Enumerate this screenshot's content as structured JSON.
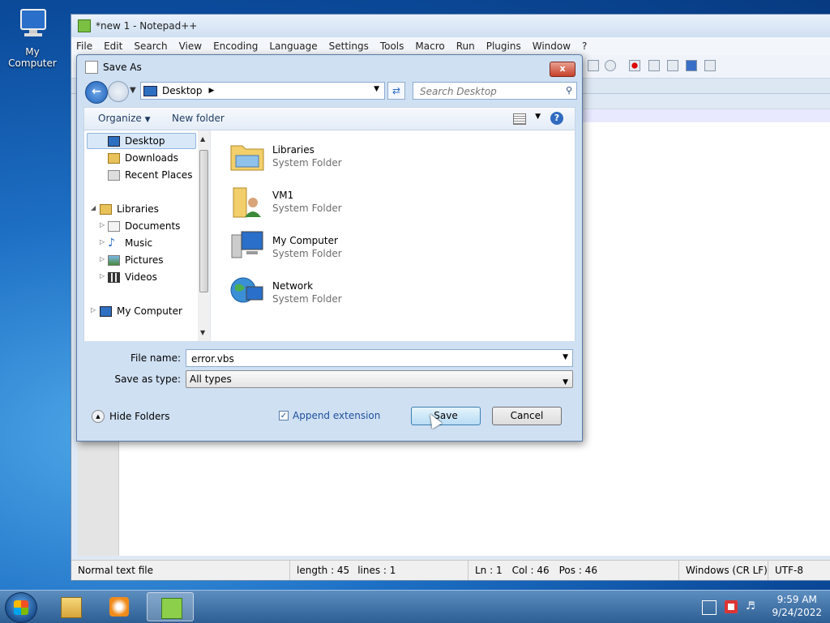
{
  "desktop": {
    "icon_label": "My Computer"
  },
  "notepad": {
    "title": "*new 1 - Notepad++",
    "menu": [
      "File",
      "Edit",
      "Search",
      "View",
      "Encoding",
      "Language",
      "Settings",
      "Tools",
      "Macro",
      "Run",
      "Plugins",
      "Window",
      "?"
    ],
    "status": {
      "file_type": "Normal text file",
      "length": "length : 45",
      "lines": "lines : 1",
      "ln": "Ln : 1",
      "col": "Col : 46",
      "pos": "Pos : 46",
      "eol": "Windows (CR LF)",
      "encoding": "UTF-8"
    }
  },
  "dialog": {
    "title": "Save As",
    "close_label": "x",
    "address": "Desktop",
    "search_placeholder": "Search Desktop",
    "organize_label": "Organize",
    "new_folder_label": "New folder",
    "help_label": "?",
    "tree": {
      "favorites": [
        "Desktop",
        "Downloads",
        "Recent Places"
      ],
      "libraries_label": "Libraries",
      "libraries": [
        "Documents",
        "Music",
        "Pictures",
        "Videos"
      ],
      "computer_label": "My Computer"
    },
    "items": [
      {
        "name": "Libraries",
        "type": "System Folder"
      },
      {
        "name": "VM1",
        "type": "System Folder"
      },
      {
        "name": "My Computer",
        "type": "System Folder"
      },
      {
        "name": "Network",
        "type": "System Folder"
      }
    ],
    "file_name_label": "File name:",
    "file_name_value": "error.vbs",
    "save_type_label": "Save as type:",
    "save_type_value": "All types",
    "hide_folders_label": "Hide Folders",
    "append_extension_label": "Append extension",
    "append_extension_checked": true,
    "save_label": "Save",
    "cancel_label": "Cancel"
  },
  "taskbar": {
    "time": "9:59 AM",
    "date": "9/24/2022"
  },
  "colors": {
    "accent": "#1c5fb8",
    "selection": "#d9e8f8",
    "taskbar": "#2d5e93"
  }
}
